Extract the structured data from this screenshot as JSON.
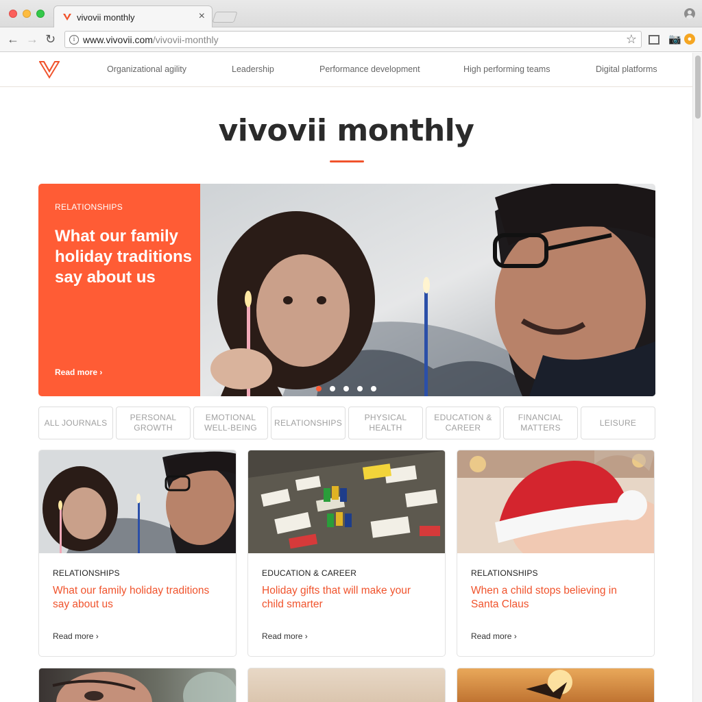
{
  "browser": {
    "tab_title": "vivovii monthly",
    "tab_close": "×",
    "url_domain": "www.vivovii.com",
    "url_path": "/vivovii-monthly",
    "back_icon": "←",
    "forward_icon": "→",
    "reload_icon": "↻",
    "star_icon": "☆"
  },
  "nav": {
    "links": [
      "Organizational agility",
      "Leadership",
      "Performance development",
      "High performing teams",
      "Digital platforms"
    ]
  },
  "page_title": "vivovii monthly",
  "hero": {
    "category": "RELATIONSHIPS",
    "title": "What our family holiday traditions say about us",
    "read_more": "Read more ›",
    "slides": 5,
    "active_slide": 1
  },
  "filters": [
    "ALL JOURNALS",
    "PERSONAL GROWTH",
    "EMOTIONAL WELL-BEING",
    "RELATIONSHIPS",
    "PHYSICAL HEALTH",
    "EDUCATION & CAREER",
    "FINANCIAL MATTERS",
    "LEISURE"
  ],
  "cards": [
    {
      "category": "RELATIONSHIPS",
      "title": "What our family holiday traditions say about us",
      "read_more": "Read more ›"
    },
    {
      "category": "EDUCATION & CAREER",
      "title": "Holiday gifts that will make your child smarter",
      "read_more": "Read more ›"
    },
    {
      "category": "RELATIONSHIPS",
      "title": "When a child stops believing in Santa Claus",
      "read_more": "Read more ›"
    }
  ],
  "colors": {
    "accent": "#ff5c35",
    "title_accent": "#f0532c"
  }
}
